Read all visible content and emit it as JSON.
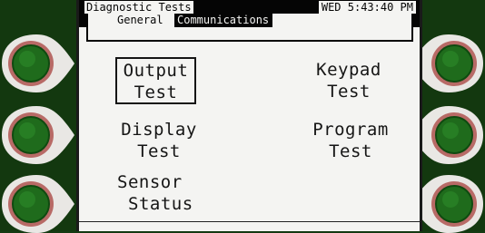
{
  "header": {
    "title": "Diagnostic Tests",
    "clock": "WED 5:43:40 PM"
  },
  "tabs": [
    {
      "label": "General",
      "active": true
    },
    {
      "label": "Communications",
      "active": false
    }
  ],
  "menu": {
    "output_test": {
      "line1": "Output",
      "line2": "Test",
      "selected": true
    },
    "keypad_test": {
      "line1": "Keypad",
      "line2": "Test"
    },
    "display_test": {
      "line1": "Display",
      "line2": "Test"
    },
    "program_test": {
      "line1": "Program",
      "line2": "Test"
    },
    "sensor_status": {
      "line1": "Sensor",
      "line2": "Status"
    }
  },
  "colors": {
    "bezel": "#13380f",
    "screen": "#f4f4f2",
    "button_ring": "#b86a66",
    "button_center": "#1f6b1c"
  },
  "icons": {
    "side_button": "round-softkey-button"
  }
}
